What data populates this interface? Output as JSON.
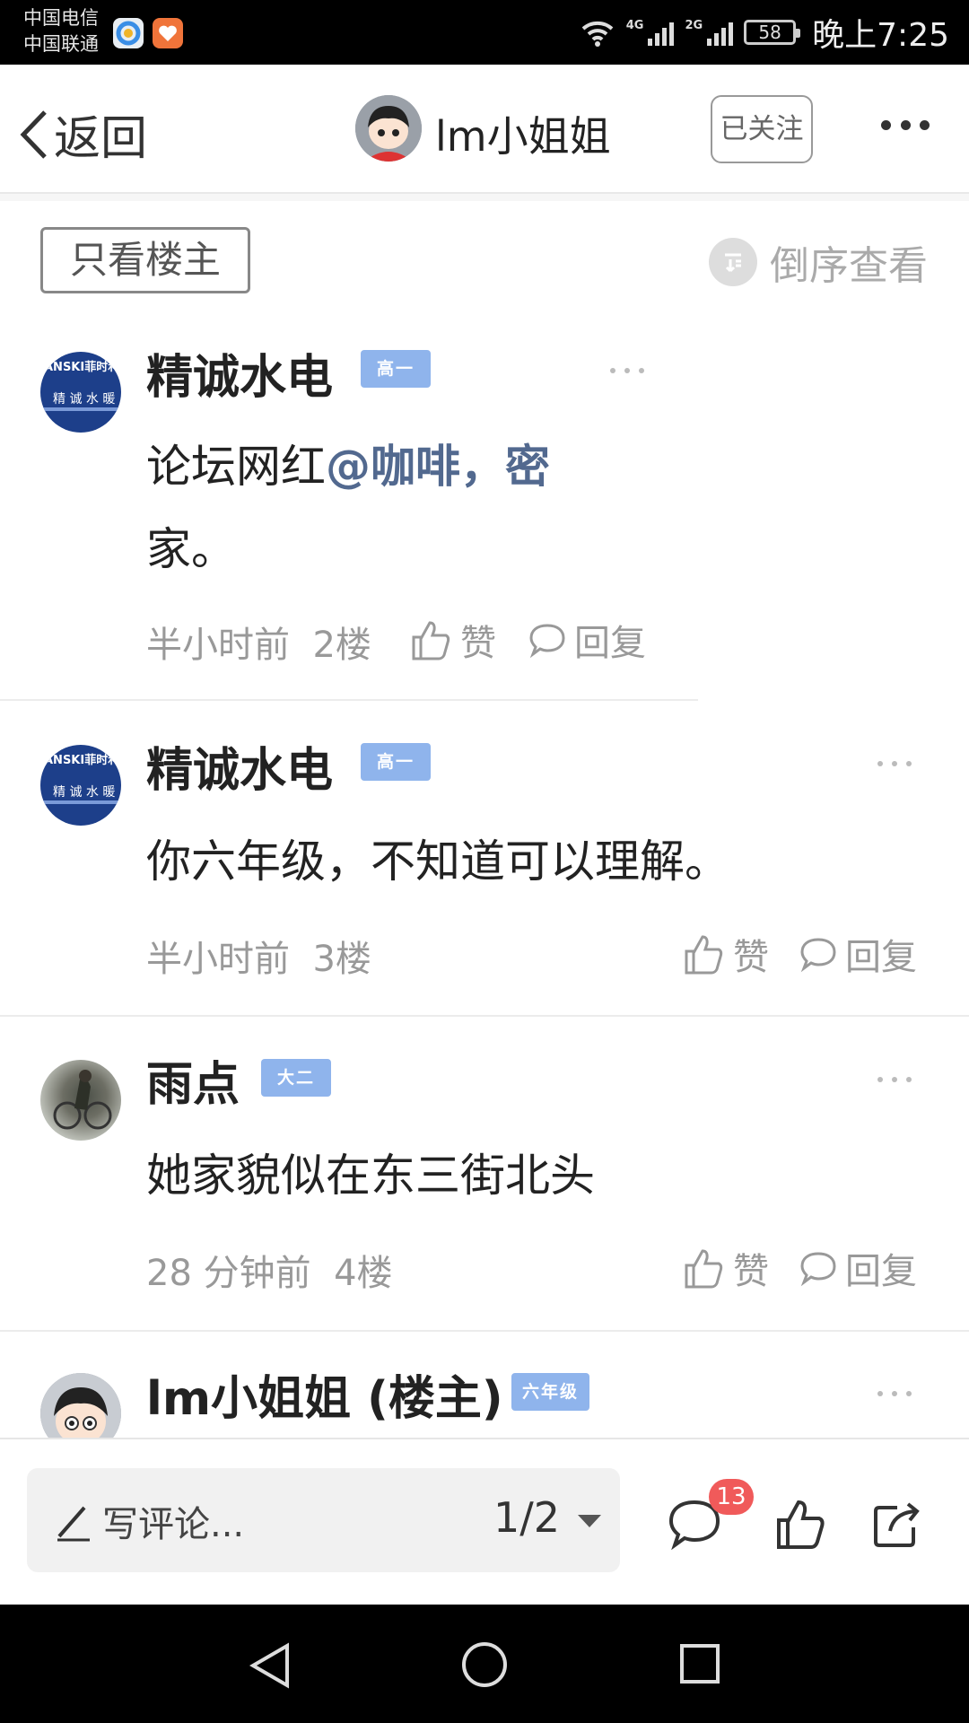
{
  "status_bar": {
    "carrier_1": "中国电信",
    "carrier_2": "中国联通",
    "net_1": "4G",
    "net_2": "2G",
    "battery": "58",
    "time": "晚上7:25"
  },
  "nav": {
    "back_label": "返回",
    "title": "lm小姐姐",
    "follow_label": "已关注"
  },
  "filter": {
    "only_host_label": "只看楼主",
    "reverse_label": "倒序查看"
  },
  "posts": [
    {
      "author": "精诚水电",
      "badge": "高一",
      "avatar_text": "ANSKI菲时利",
      "avatar_sub": "精 诚 水 暖",
      "content_prefix": "论坛网红",
      "mention": "@咖啡，密",
      "content_line2": "家。",
      "time": "半小时前",
      "floor": "2楼",
      "like_label": "赞",
      "reply_label": "回复"
    },
    {
      "author": "精诚水电",
      "badge": "高一",
      "avatar_text": "ANSKI菲时利",
      "avatar_sub": "精 诚 水 暖",
      "content": "你六年级，不知道可以理解。",
      "time": "半小时前",
      "floor": "3楼",
      "like_label": "赞",
      "reply_label": "回复"
    },
    {
      "author": "雨点",
      "badge": "大二",
      "content": "她家貌似在东三街北头",
      "time": "28 分钟前",
      "floor": "4楼",
      "like_label": "赞",
      "reply_label": "回复"
    },
    {
      "author": "lm小姐姐 (楼主)",
      "badge": "六年级"
    }
  ],
  "bottom_bar": {
    "comment_placeholder": "写评论...",
    "page_indicator": "1/2",
    "comment_count": "13"
  },
  "colors": {
    "badge": "#8fb4ec",
    "mention": "#52698f",
    "notification": "#f05a5a"
  }
}
